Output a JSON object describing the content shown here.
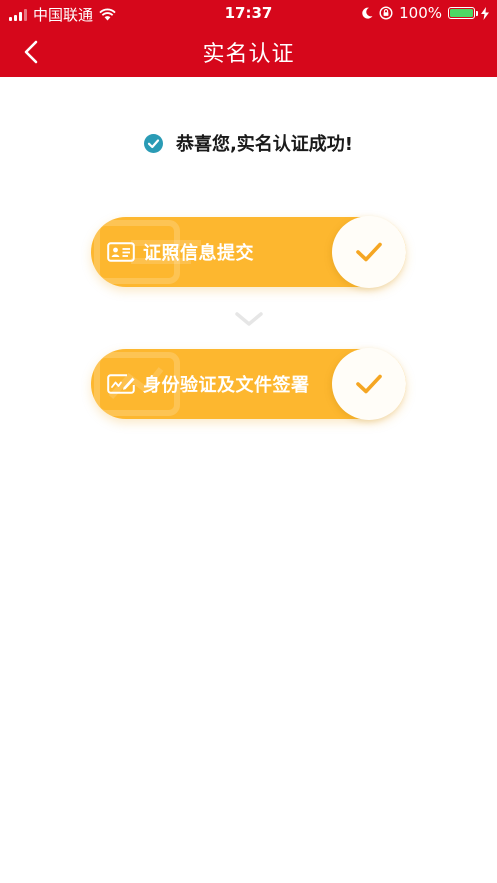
{
  "status_bar": {
    "carrier": "中国联通",
    "time": "17:37",
    "battery": "100%"
  },
  "nav": {
    "title": "实名认证"
  },
  "success": {
    "message": "恭喜您,实名认证成功!"
  },
  "steps": [
    {
      "label": "证照信息提交",
      "icon": "id-card-icon",
      "status": "done"
    },
    {
      "label": "身份验证及文件签署",
      "icon": "signature-icon",
      "status": "done"
    }
  ],
  "colors": {
    "header_bg": "#d6071b",
    "step_bg": "#fdb72f",
    "success_check": "#2a9bb5",
    "battery": "#4cd964"
  }
}
